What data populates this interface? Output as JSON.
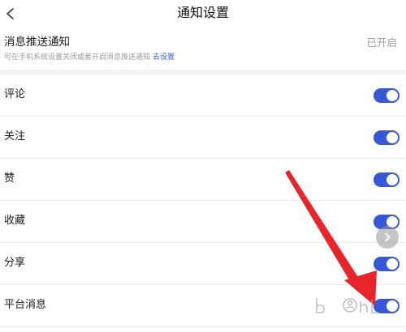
{
  "header": {
    "back_icon": "chevron-left-icon",
    "title": "通知设置"
  },
  "push": {
    "title": "消息推送通知",
    "status": "已开启",
    "hint": "可在手机系统设置关闭或者开启消息推送通知",
    "link": "去设置"
  },
  "rows": [
    {
      "label": "评论",
      "enabled": true
    },
    {
      "label": "关注",
      "enabled": true
    },
    {
      "label": "赞",
      "enabled": true
    },
    {
      "label": "收藏",
      "enabled": true
    },
    {
      "label": "分享",
      "enabled": true
    },
    {
      "label": "平台消息",
      "enabled": true
    }
  ],
  "colors": {
    "toggle_on": "#3657d6",
    "link": "#3d5bd9",
    "arrow": "#e8252b"
  },
  "overlay": {
    "next_icon": "chevron-right-icon",
    "annotation": "red-arrow-pointing-at-platform-toggle"
  }
}
